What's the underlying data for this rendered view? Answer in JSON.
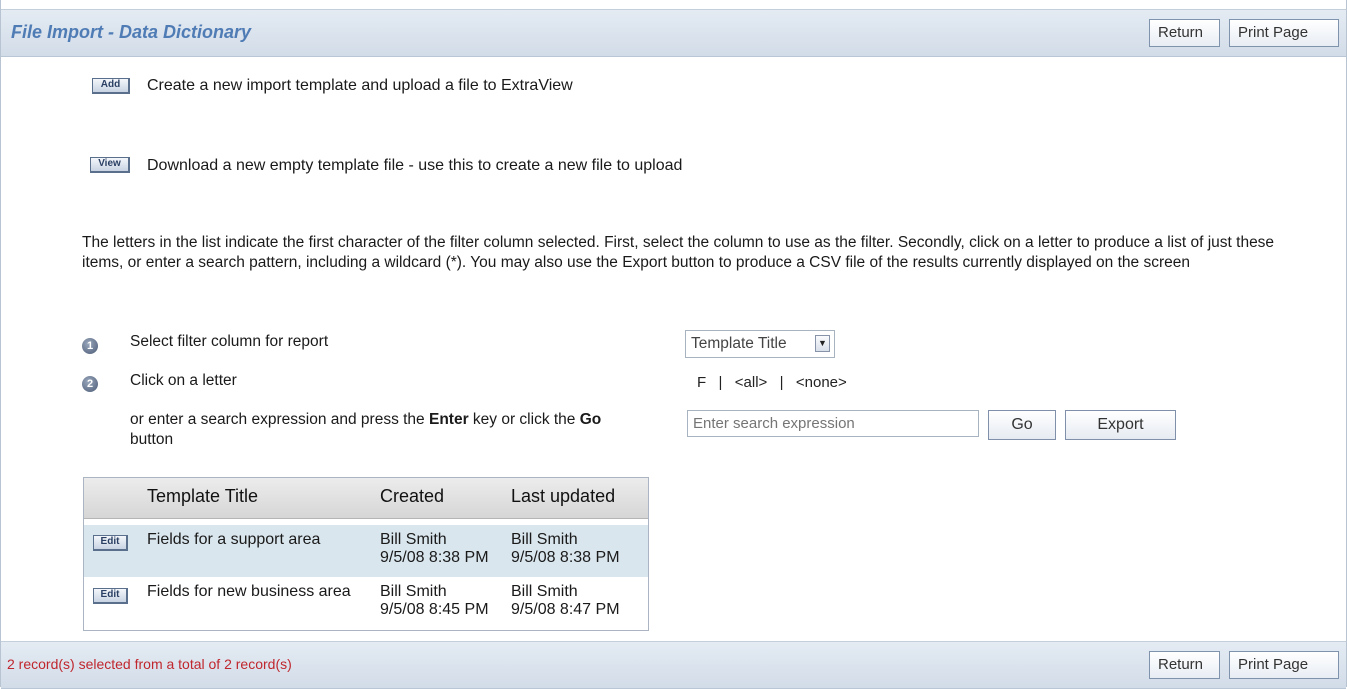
{
  "header": {
    "title": "File Import - Data Dictionary",
    "return_label": "Return",
    "print_label": "Print Page"
  },
  "actions": [
    {
      "button": "Add",
      "text": "Create a new import template and upload a file to ExtraView"
    },
    {
      "button": "View",
      "text": "Download a new empty template file - use this to create a new file to upload"
    }
  ],
  "description": "The letters in the list indicate the first character of the filter column selected. First, select the column to use as the filter. Secondly, click on a letter to produce a list of just these items, or enter a search pattern, including a wildcard (*). You may also use the Export button to produce a CSV file of the results currently displayed on the screen",
  "steps": {
    "step1_num": "1",
    "step1_label": "Select filter column for report",
    "step2_num": "2",
    "step2_label": "Click on a letter",
    "search_text_before": "or enter a search expression and press the ",
    "search_text_enter": "Enter",
    "search_text_middle": " key or click the ",
    "search_text_go": "Go",
    "search_text_after": "button"
  },
  "filter": {
    "selected": "Template Title",
    "letters": [
      "F",
      "<all>",
      "<none>"
    ],
    "separator": "|",
    "search_placeholder": "Enter search expression",
    "go_label": "Go",
    "export_label": "Export"
  },
  "table": {
    "columns": [
      "Template Title",
      "Created",
      "Last updated"
    ],
    "rows": [
      {
        "edit": "Edit",
        "title": "Fields for a support area",
        "created_by": "Bill Smith",
        "created_at": "9/5/08 8:38 PM",
        "updated_by": "Bill Smith",
        "updated_at": "9/5/08 8:38 PM"
      },
      {
        "edit": "Edit",
        "title": "Fields for new business area",
        "created_by": "Bill Smith",
        "created_at": "9/5/08 8:45 PM",
        "updated_by": "Bill Smith",
        "updated_at": "9/5/08 8:47 PM"
      }
    ]
  },
  "footer": {
    "status": "2 record(s) selected from a total of 2 record(s)",
    "return_label": "Return",
    "print_label": "Print Page"
  },
  "colors": {
    "title": "#4f7cb5",
    "status": "#c0262d",
    "row_highlight": "#dae6ee"
  }
}
